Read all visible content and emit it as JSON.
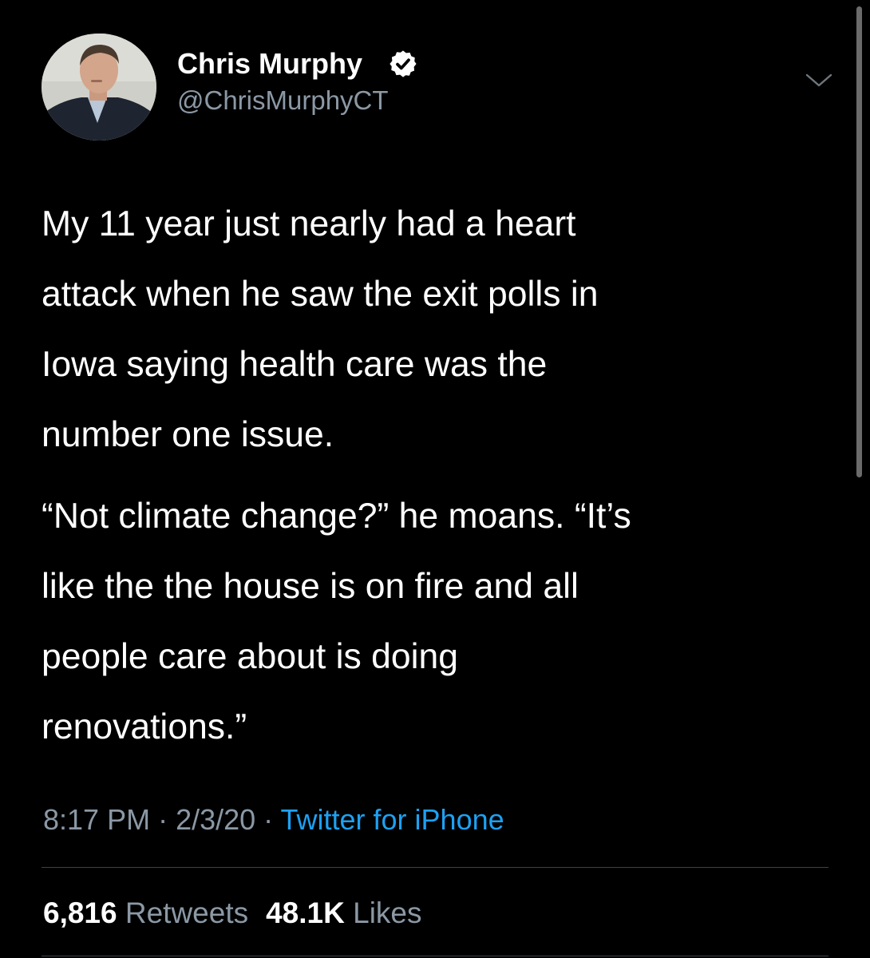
{
  "author": {
    "display_name": "Chris Murphy",
    "handle": "@ChrisMurphyCT",
    "verified": true,
    "verified_icon": "verified-badge-icon",
    "avatar": "profile-photo"
  },
  "menu_icon": "chevron-down-icon",
  "tweet": {
    "paragraph1": [
      "My 11 year just nearly had a heart",
      "attack when he saw the exit polls in",
      "Iowa saying health care was the",
      "number one issue."
    ],
    "paragraph2": [
      "“Not climate change?” he moans. “It’s",
      "like the the house is on fire and all",
      "people care about is doing",
      "renovations.”"
    ]
  },
  "meta": {
    "time": "8:17 PM",
    "separator": " · ",
    "date": "2/3/20",
    "source": "Twitter for iPhone"
  },
  "stats": {
    "retweets_count": "6,816",
    "retweets_label": "Retweets",
    "likes_count": "48.1K",
    "likes_label": "Likes"
  },
  "colors": {
    "background": "#000000",
    "text_primary": "#ffffff",
    "text_secondary": "#8b98a5",
    "accent": "#1da1f2",
    "divider": "#38444d"
  }
}
